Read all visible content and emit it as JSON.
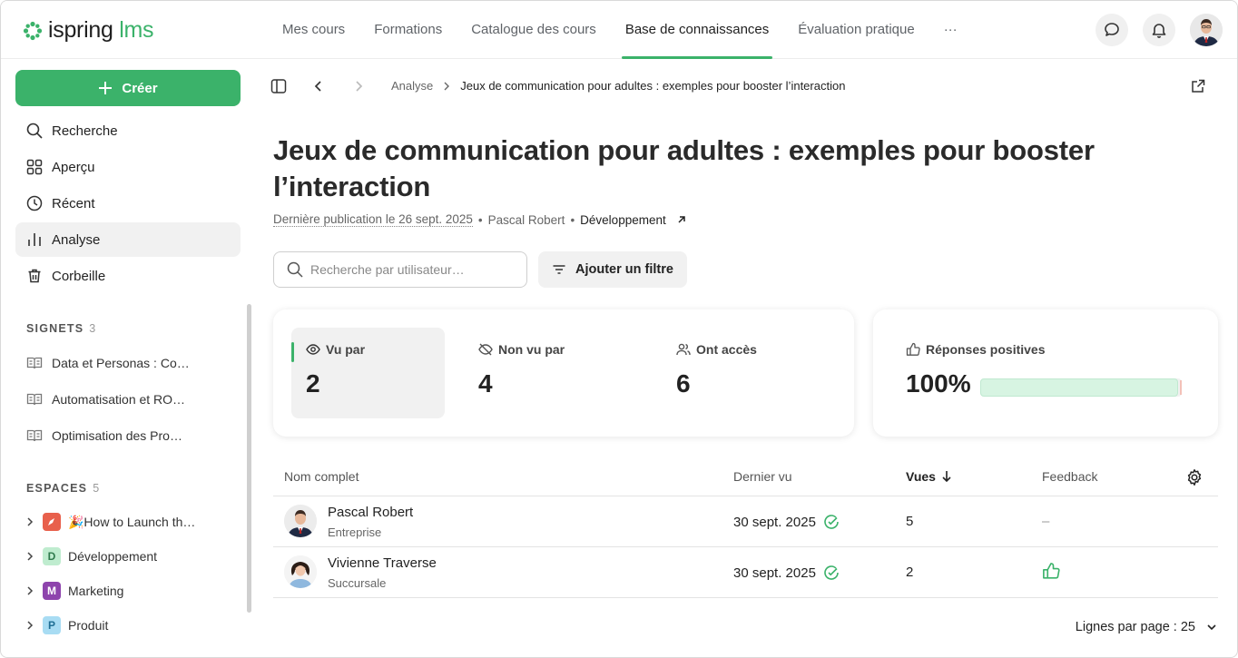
{
  "app": {
    "logo_brand": "ispring",
    "logo_product": "lms"
  },
  "topnav": {
    "items": [
      "Mes cours",
      "Formations",
      "Catalogue des cours",
      "Base de connaissances",
      "Évaluation pratique"
    ],
    "active": "Base de connaissances",
    "more_label": "···"
  },
  "sidebar": {
    "create_label": "Créer",
    "items": [
      {
        "label": "Recherche",
        "icon": "search-icon"
      },
      {
        "label": "Aperçu",
        "icon": "grid-icon"
      },
      {
        "label": "Récent",
        "icon": "clock-icon"
      },
      {
        "label": "Analyse",
        "icon": "bar-chart-icon",
        "active": true
      },
      {
        "label": "Corbeille",
        "icon": "trash-icon"
      }
    ],
    "bookmarks": {
      "title": "SIGNETS",
      "count": "3",
      "items": [
        "Data et Personas : Co…",
        "Automatisation et RO…",
        "Optimisation des Pro…"
      ]
    },
    "spaces": {
      "title": "ESPACES",
      "count": "5",
      "items": [
        {
          "letter": "",
          "label": "🎉How to Launch th…",
          "color": "#e8604c"
        },
        {
          "letter": "D",
          "label": "Développement",
          "color": "#bfeccf"
        },
        {
          "letter": "M",
          "label": "Marketing",
          "color": "#8e44ad"
        },
        {
          "letter": "P",
          "label": "Produit",
          "color": "#a8dcf3"
        }
      ]
    }
  },
  "breadcrumb": {
    "parent": "Analyse",
    "current": "Jeux de communication pour adultes : exemples pour booster l’interaction"
  },
  "article": {
    "title": "Jeux de communication pour adultes : exemples pour booster l’interaction",
    "published": "Dernière publication le 26 sept. 2025",
    "author": "Pascal Robert",
    "space": "Développement"
  },
  "search": {
    "placeholder": "Recherche par utilisateur…",
    "value": ""
  },
  "filter_label": "Ajouter un filtre",
  "stats": {
    "seen": {
      "label": "Vu par",
      "value": "2"
    },
    "not_seen": {
      "label": "Non vu par",
      "value": "4"
    },
    "access": {
      "label": "Ont accès",
      "value": "6"
    },
    "positive": {
      "label": "Réponses positives",
      "value": "100%",
      "fraction": 1.0
    }
  },
  "table": {
    "headers": {
      "name": "Nom complet",
      "last_seen": "Dernier vu",
      "views": "Vues",
      "feedback": "Feedback"
    },
    "rows": [
      {
        "name": "Pascal Robert",
        "org": "Entreprise",
        "last_seen": "30 sept. 2025",
        "views": "5",
        "feedback": "–"
      },
      {
        "name": "Vivienne Traverse",
        "org": "Succursale",
        "last_seen": "30 sept. 2025",
        "views": "2",
        "feedback": "thumbs-up-icon"
      }
    ]
  },
  "pagination": {
    "rows_per_page": "Lignes par page : 25"
  },
  "colors": {
    "accent": "#3bb26a"
  }
}
